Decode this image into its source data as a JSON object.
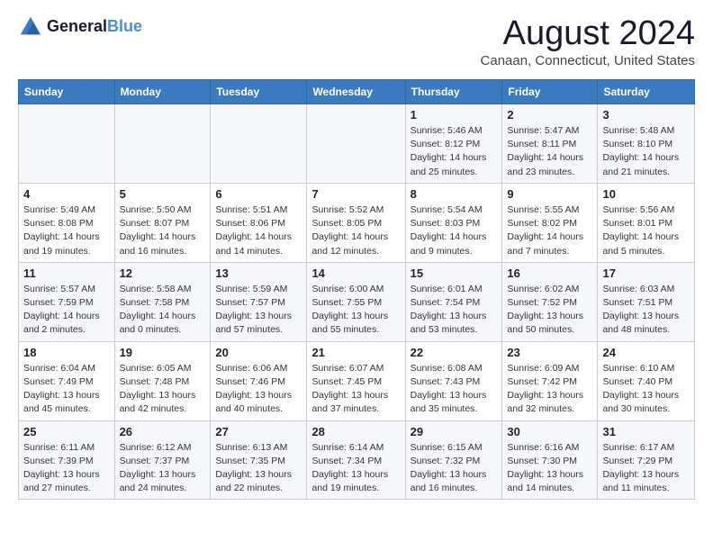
{
  "header": {
    "logo_line1": "General",
    "logo_line2": "Blue",
    "month": "August 2024",
    "location": "Canaan, Connecticut, United States"
  },
  "weekdays": [
    "Sunday",
    "Monday",
    "Tuesday",
    "Wednesday",
    "Thursday",
    "Friday",
    "Saturday"
  ],
  "weeks": [
    [
      {
        "day": "",
        "info": ""
      },
      {
        "day": "",
        "info": ""
      },
      {
        "day": "",
        "info": ""
      },
      {
        "day": "",
        "info": ""
      },
      {
        "day": "1",
        "info": "Sunrise: 5:46 AM\nSunset: 8:12 PM\nDaylight: 14 hours\nand 25 minutes."
      },
      {
        "day": "2",
        "info": "Sunrise: 5:47 AM\nSunset: 8:11 PM\nDaylight: 14 hours\nand 23 minutes."
      },
      {
        "day": "3",
        "info": "Sunrise: 5:48 AM\nSunset: 8:10 PM\nDaylight: 14 hours\nand 21 minutes."
      }
    ],
    [
      {
        "day": "4",
        "info": "Sunrise: 5:49 AM\nSunset: 8:08 PM\nDaylight: 14 hours\nand 19 minutes."
      },
      {
        "day": "5",
        "info": "Sunrise: 5:50 AM\nSunset: 8:07 PM\nDaylight: 14 hours\nand 16 minutes."
      },
      {
        "day": "6",
        "info": "Sunrise: 5:51 AM\nSunset: 8:06 PM\nDaylight: 14 hours\nand 14 minutes."
      },
      {
        "day": "7",
        "info": "Sunrise: 5:52 AM\nSunset: 8:05 PM\nDaylight: 14 hours\nand 12 minutes."
      },
      {
        "day": "8",
        "info": "Sunrise: 5:54 AM\nSunset: 8:03 PM\nDaylight: 14 hours\nand 9 minutes."
      },
      {
        "day": "9",
        "info": "Sunrise: 5:55 AM\nSunset: 8:02 PM\nDaylight: 14 hours\nand 7 minutes."
      },
      {
        "day": "10",
        "info": "Sunrise: 5:56 AM\nSunset: 8:01 PM\nDaylight: 14 hours\nand 5 minutes."
      }
    ],
    [
      {
        "day": "11",
        "info": "Sunrise: 5:57 AM\nSunset: 7:59 PM\nDaylight: 14 hours\nand 2 minutes."
      },
      {
        "day": "12",
        "info": "Sunrise: 5:58 AM\nSunset: 7:58 PM\nDaylight: 14 hours\nand 0 minutes."
      },
      {
        "day": "13",
        "info": "Sunrise: 5:59 AM\nSunset: 7:57 PM\nDaylight: 13 hours\nand 57 minutes."
      },
      {
        "day": "14",
        "info": "Sunrise: 6:00 AM\nSunset: 7:55 PM\nDaylight: 13 hours\nand 55 minutes."
      },
      {
        "day": "15",
        "info": "Sunrise: 6:01 AM\nSunset: 7:54 PM\nDaylight: 13 hours\nand 53 minutes."
      },
      {
        "day": "16",
        "info": "Sunrise: 6:02 AM\nSunset: 7:52 PM\nDaylight: 13 hours\nand 50 minutes."
      },
      {
        "day": "17",
        "info": "Sunrise: 6:03 AM\nSunset: 7:51 PM\nDaylight: 13 hours\nand 48 minutes."
      }
    ],
    [
      {
        "day": "18",
        "info": "Sunrise: 6:04 AM\nSunset: 7:49 PM\nDaylight: 13 hours\nand 45 minutes."
      },
      {
        "day": "19",
        "info": "Sunrise: 6:05 AM\nSunset: 7:48 PM\nDaylight: 13 hours\nand 42 minutes."
      },
      {
        "day": "20",
        "info": "Sunrise: 6:06 AM\nSunset: 7:46 PM\nDaylight: 13 hours\nand 40 minutes."
      },
      {
        "day": "21",
        "info": "Sunrise: 6:07 AM\nSunset: 7:45 PM\nDaylight: 13 hours\nand 37 minutes."
      },
      {
        "day": "22",
        "info": "Sunrise: 6:08 AM\nSunset: 7:43 PM\nDaylight: 13 hours\nand 35 minutes."
      },
      {
        "day": "23",
        "info": "Sunrise: 6:09 AM\nSunset: 7:42 PM\nDaylight: 13 hours\nand 32 minutes."
      },
      {
        "day": "24",
        "info": "Sunrise: 6:10 AM\nSunset: 7:40 PM\nDaylight: 13 hours\nand 30 minutes."
      }
    ],
    [
      {
        "day": "25",
        "info": "Sunrise: 6:11 AM\nSunset: 7:39 PM\nDaylight: 13 hours\nand 27 minutes."
      },
      {
        "day": "26",
        "info": "Sunrise: 6:12 AM\nSunset: 7:37 PM\nDaylight: 13 hours\nand 24 minutes."
      },
      {
        "day": "27",
        "info": "Sunrise: 6:13 AM\nSunset: 7:35 PM\nDaylight: 13 hours\nand 22 minutes."
      },
      {
        "day": "28",
        "info": "Sunrise: 6:14 AM\nSunset: 7:34 PM\nDaylight: 13 hours\nand 19 minutes."
      },
      {
        "day": "29",
        "info": "Sunrise: 6:15 AM\nSunset: 7:32 PM\nDaylight: 13 hours\nand 16 minutes."
      },
      {
        "day": "30",
        "info": "Sunrise: 6:16 AM\nSunset: 7:30 PM\nDaylight: 13 hours\nand 14 minutes."
      },
      {
        "day": "31",
        "info": "Sunrise: 6:17 AM\nSunset: 7:29 PM\nDaylight: 13 hours\nand 11 minutes."
      }
    ]
  ]
}
